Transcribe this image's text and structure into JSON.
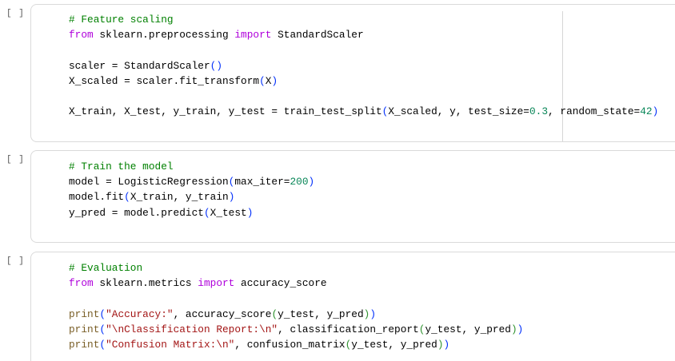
{
  "cells": [
    {
      "prompt": "[ ]",
      "lines": [
        [
          [
            "# Feature scaling",
            "c"
          ]
        ],
        [
          [
            "from",
            "k"
          ],
          [
            " sklearn.preprocessing ",
            ""
          ],
          [
            "import",
            "k"
          ],
          [
            " StandardScaler",
            ""
          ]
        ],
        [],
        [
          [
            "scaler = StandardScaler",
            ""
          ],
          [
            "()",
            "b"
          ]
        ],
        [
          [
            "X_scaled = scaler.fit_transform",
            ""
          ],
          [
            "(",
            "b"
          ],
          [
            "X",
            ""
          ],
          [
            ")",
            "b"
          ]
        ],
        [],
        [
          [
            "X_train, X_test, y_train, y_test = train_test_split",
            ""
          ],
          [
            "(",
            "b"
          ],
          [
            "X_scaled, y, test_size=",
            ""
          ],
          [
            "0.3",
            "n"
          ],
          [
            ", random_state=",
            ""
          ],
          [
            "42",
            "n"
          ],
          [
            ")",
            "b"
          ]
        ]
      ]
    },
    {
      "prompt": "[ ]",
      "lines": [
        [
          [
            "# Train the model",
            "c"
          ]
        ],
        [
          [
            "model = LogisticRegression",
            ""
          ],
          [
            "(",
            "b"
          ],
          [
            "max_iter=",
            ""
          ],
          [
            "200",
            "n"
          ],
          [
            ")",
            "b"
          ]
        ],
        [
          [
            "model.fit",
            ""
          ],
          [
            "(",
            "b"
          ],
          [
            "X_train, y_train",
            ""
          ],
          [
            ")",
            "b"
          ]
        ],
        [
          [
            "y_pred = model.predict",
            ""
          ],
          [
            "(",
            "b"
          ],
          [
            "X_test",
            ""
          ],
          [
            ")",
            "b"
          ]
        ]
      ]
    },
    {
      "prompt": "[ ]",
      "lines": [
        [
          [
            "# Evaluation",
            "c"
          ]
        ],
        [
          [
            "from",
            "k"
          ],
          [
            " sklearn.metrics ",
            ""
          ],
          [
            "import",
            "k"
          ],
          [
            " accuracy_score",
            ""
          ]
        ],
        [],
        [
          [
            "print",
            "f"
          ],
          [
            "(",
            "b"
          ],
          [
            "\"Accuracy:\"",
            "s"
          ],
          [
            ", accuracy_score",
            ""
          ],
          [
            "(",
            "g"
          ],
          [
            "y_test, y_pred",
            ""
          ],
          [
            ")",
            "g"
          ],
          [
            ")",
            "b"
          ]
        ],
        [
          [
            "print",
            "f"
          ],
          [
            "(",
            "b"
          ],
          [
            "\"\\nClassification Report:\\n\"",
            "s"
          ],
          [
            ", classification_report",
            ""
          ],
          [
            "(",
            "g"
          ],
          [
            "y_test, y_pred",
            ""
          ],
          [
            ")",
            "g"
          ],
          [
            ")",
            "b"
          ]
        ],
        [
          [
            "print",
            "f"
          ],
          [
            "(",
            "b"
          ],
          [
            "\"Confusion Matrix:\\n\"",
            "s"
          ],
          [
            ", confusion_matrix",
            ""
          ],
          [
            "(",
            "g"
          ],
          [
            "y_test, y_pred",
            ""
          ],
          [
            ")",
            "g"
          ],
          [
            ")",
            "b"
          ]
        ]
      ]
    }
  ]
}
